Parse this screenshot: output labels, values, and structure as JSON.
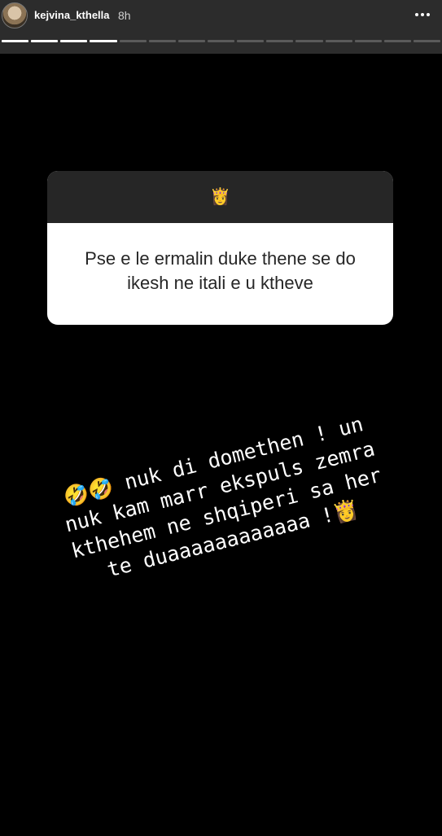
{
  "header": {
    "username": "kejvina_kthella",
    "time": "8h",
    "more_icon": "more-horizontal-icon"
  },
  "progress": {
    "segments_total": 15,
    "segments_viewed": 4
  },
  "question": {
    "icon": "👸",
    "text": "Pse e le ermalin duke thene se do ikesh ne itali e u ktheve"
  },
  "answer": {
    "text": "🤣🤣 nuk di domethen ! un\nnuk kam marr ekspuls zemra\nkthehem ne shqiperi sa her\nte duaaaaaaaaaaaa   !👸"
  },
  "colors": {
    "background": "#000000",
    "header": "#2c2c2c",
    "question_header": "#262626",
    "question_body": "#ffffff"
  }
}
